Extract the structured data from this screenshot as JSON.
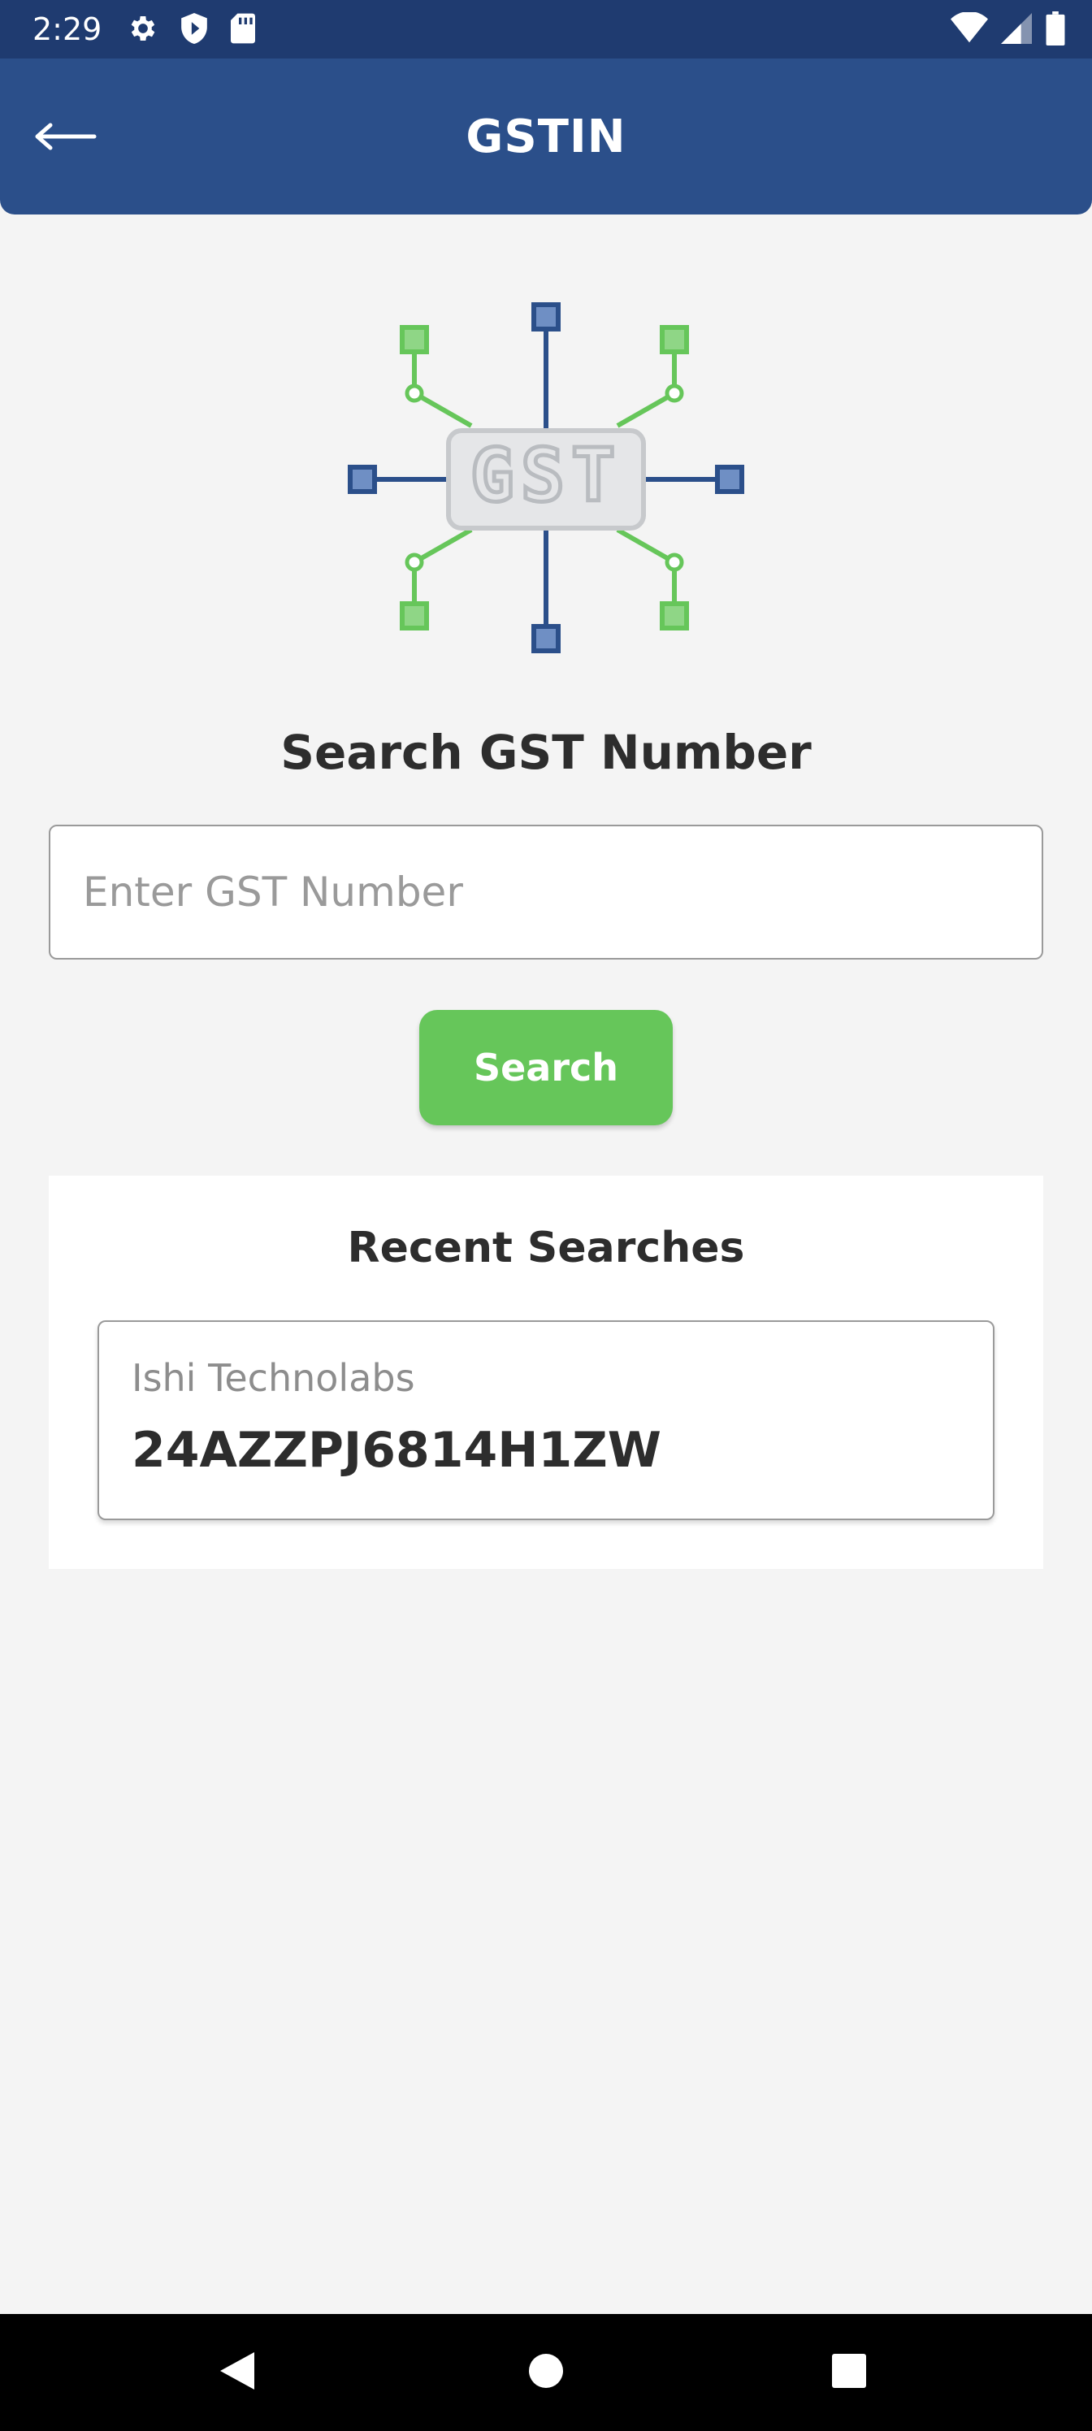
{
  "status_bar": {
    "time": "2:29",
    "icons_left": [
      "gear-icon",
      "shield-icon",
      "sd-card-icon"
    ],
    "icons_right": [
      "wifi-icon",
      "signal-icon",
      "battery-icon"
    ]
  },
  "app_bar": {
    "title": "GSTIN",
    "back_icon": "arrow-left-icon"
  },
  "hero": {
    "logo_text": "GST",
    "colors": {
      "blue": "#2b4f8a",
      "green": "#66c65a",
      "grey": "#c7c9cc"
    }
  },
  "search": {
    "title": "Search GST Number",
    "placeholder": "Enter GST Number",
    "value": "",
    "button_label": "Search"
  },
  "recent": {
    "title": "Recent Searches",
    "items": [
      {
        "name": "Ishi Technolabs",
        "gstin": "24AZZPJ6814H1ZW"
      }
    ]
  },
  "nav": {
    "icons": [
      "back-triangle-icon",
      "home-circle-icon",
      "recents-square-icon"
    ]
  },
  "colors": {
    "primary": "#2b4f8a",
    "status_bar": "#1f3b70",
    "accent": "#66c65a",
    "background": "#f4f4f4"
  }
}
